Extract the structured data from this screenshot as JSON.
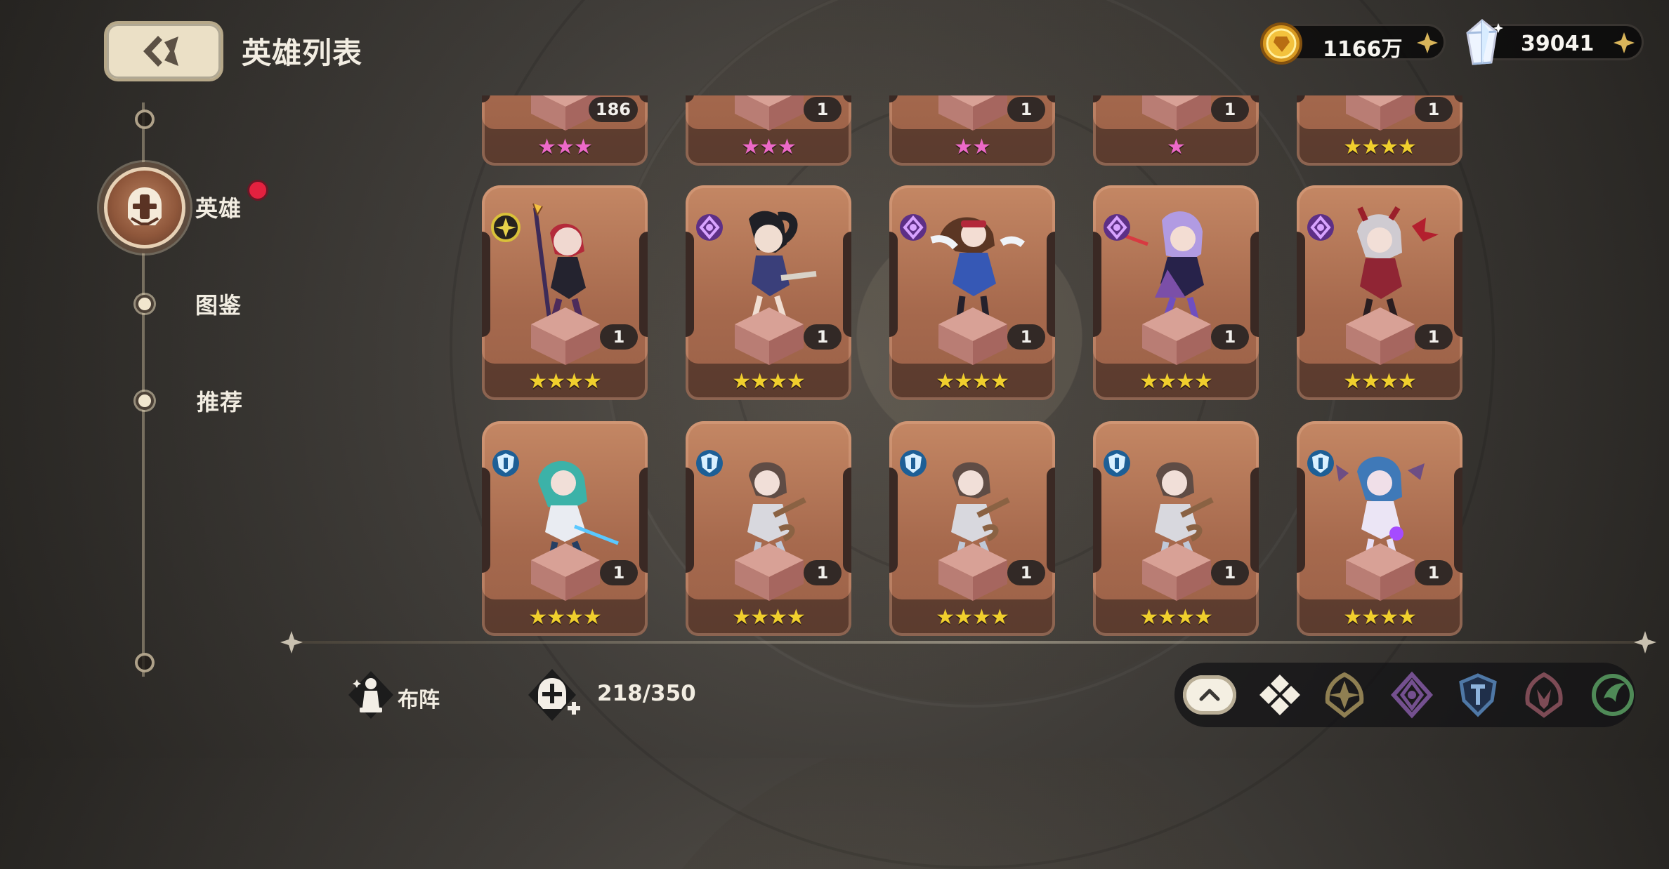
{
  "header": {
    "title": "英雄列表"
  },
  "sidebar": {
    "items": [
      {
        "label": "英雄",
        "active": true,
        "notification": true
      },
      {
        "label": "图鉴",
        "active": false
      },
      {
        "label": "推荐",
        "active": false
      }
    ]
  },
  "currency": {
    "gold": "1166万",
    "gems": "39041"
  },
  "cards": {
    "top_row": [
      {
        "level": "186",
        "stars": "★★★",
        "color": "pink"
      },
      {
        "level": "1",
        "stars": "★★★",
        "color": "pink"
      },
      {
        "level": "1",
        "stars": "★★",
        "color": "pink"
      },
      {
        "level": "1",
        "stars": "★",
        "color": "pink"
      },
      {
        "level": "1",
        "stars": "★★★★",
        "color": "gold"
      }
    ],
    "middle_row": [
      {
        "level": "1",
        "stars": "★★★★",
        "class_icon": "attack-class-icon",
        "accent": "#b42a3a"
      },
      {
        "level": "1",
        "stars": "★★★★",
        "class_icon": "mage-class-icon",
        "accent": "#3a3f7a"
      },
      {
        "level": "1",
        "stars": "★★★★",
        "class_icon": "mage-class-icon",
        "accent": "#3658b5"
      },
      {
        "level": "1",
        "stars": "★★★★",
        "class_icon": "mage-class-icon",
        "accent": "#7b4fa8"
      },
      {
        "level": "1",
        "stars": "★★★★",
        "class_icon": "mage-class-icon",
        "accent": "#902534"
      }
    ],
    "bottom_row": [
      {
        "level": "1",
        "stars": "★★★★",
        "class_icon": "defense-class-icon",
        "accent": "#3cb2a8"
      },
      {
        "level": "1",
        "stars": "★★★★",
        "class_icon": "defense-class-icon",
        "accent": "#5f4c45"
      },
      {
        "level": "1",
        "stars": "★★★★",
        "class_icon": "defense-class-icon",
        "accent": "#5f4c45"
      },
      {
        "level": "1",
        "stars": "★★★★",
        "class_icon": "defense-class-icon",
        "accent": "#5f4c45"
      },
      {
        "level": "1",
        "stars": "★★★★",
        "class_icon": "defense-class-icon",
        "accent": "#3f79b8"
      }
    ]
  },
  "bottom_bar": {
    "formation_label": "布阵",
    "capacity": "218/350"
  },
  "filters": {
    "items": [
      "collapse-icon",
      "all-icon",
      "attack-class-icon",
      "mage-class-icon",
      "defense-class-icon",
      "assassin-class-icon",
      "support-class-icon"
    ]
  },
  "colors": {
    "gold_star": "#f0cf2d",
    "pink_star": "#ec69c8",
    "notification": "#e4213f",
    "mage": "#8d4fbe",
    "defense": "#2185c9"
  }
}
